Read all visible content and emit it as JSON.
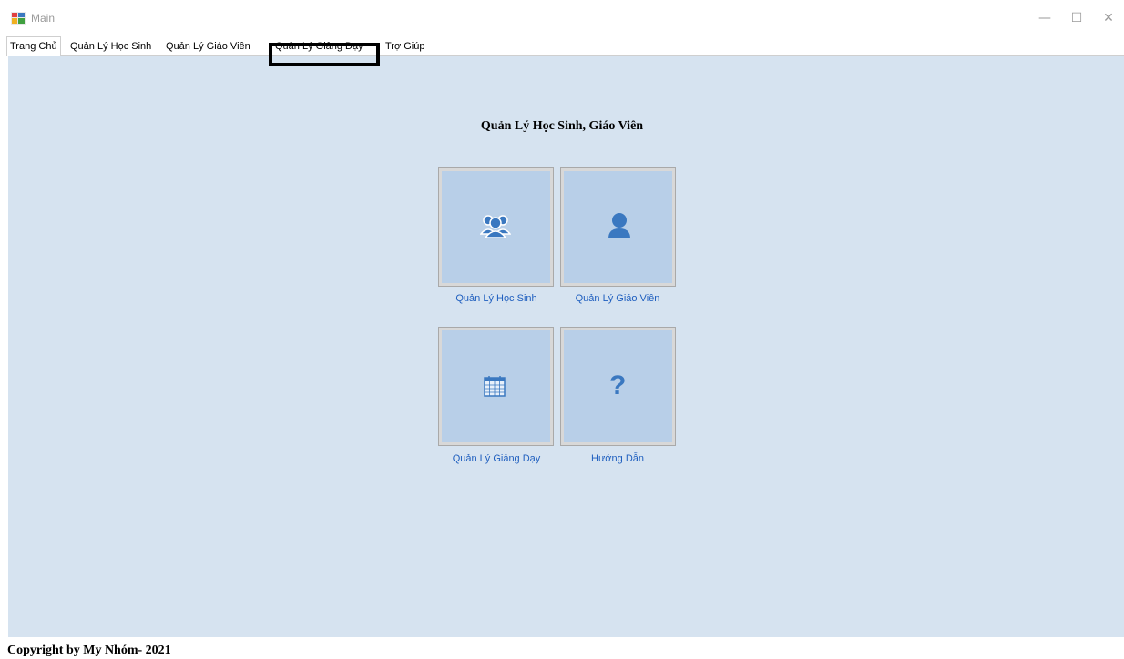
{
  "window": {
    "title": "Main",
    "controls": {
      "minimize": "—",
      "maximize": "☐",
      "close": "✕"
    }
  },
  "tabs": [
    {
      "label": "Trang Chủ",
      "active": true
    },
    {
      "label": "Quản Lý Học Sinh"
    },
    {
      "label": "Quản Lý Giáo Viên"
    },
    {
      "label": "Quản Lý Giảng Dạy",
      "highlighted": true
    },
    {
      "label": "Trợ Giúp"
    }
  ],
  "main": {
    "heading": "Quản Lý Học Sinh, Giáo Viên",
    "tiles": [
      {
        "label": "Quản Lý Học Sinh",
        "icon": "students-group-icon"
      },
      {
        "label": "Quản Lý Giáo Viên",
        "icon": "teacher-person-icon"
      },
      {
        "label": "Quản Lý Giảng Dạy",
        "icon": "calendar-icon"
      },
      {
        "label": "Hướng Dẫn",
        "icon": "question-mark-icon"
      }
    ]
  },
  "footer": {
    "text": "Copyright by My Nhóm- 2021"
  },
  "colors": {
    "content_bg": "#d6e3f0",
    "tile_bg": "#b8cfe8",
    "icon": "#3a78c0",
    "link": "#1f5fbf"
  }
}
